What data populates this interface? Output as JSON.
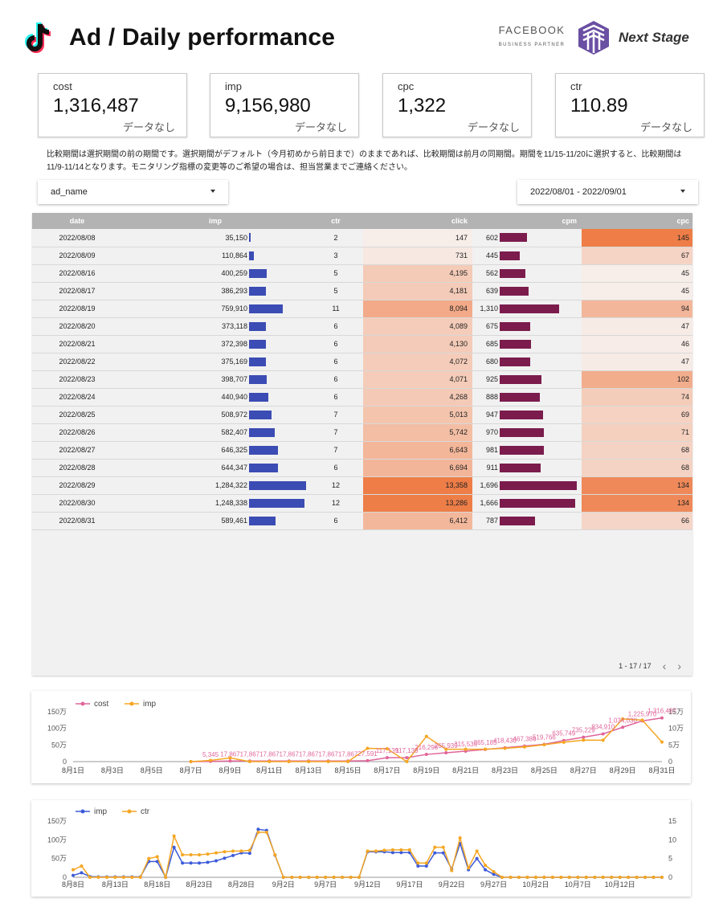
{
  "header": {
    "title": "Ad / Daily performance",
    "partner_top": "FACEBOOK",
    "partner_bottom": "BUSINESS PARTNER",
    "brand": "Next Stage"
  },
  "kpis": [
    {
      "label": "cost",
      "value": "1,316,487",
      "compare": "データなし"
    },
    {
      "label": "imp",
      "value": "9,156,980",
      "compare": "データなし"
    },
    {
      "label": "cpc",
      "value": "1,322",
      "compare": "データなし"
    },
    {
      "label": "ctr",
      "value": "110.89",
      "compare": "データなし"
    }
  ],
  "note": "比較期間は選択期間の前の期間です。選択期間がデフォルト（今月初めから前日まで）のままであれば、比較期間は前月の同期間。期間を11/15-11/20に選択すると、比較期間は11/9-11/14となります。モニタリング指標の変更等のご希望の場合は、担当営業までご連絡ください。",
  "filters": {
    "dimension": "ad_name",
    "date_range": "2022/08/01 - 2022/09/01"
  },
  "table": {
    "columns": [
      "date",
      "imp",
      "ctr",
      "click",
      "cpm",
      "cpc"
    ],
    "rows": [
      {
        "date": "2022/08/08",
        "imp": "35,150",
        "imp_v": 35150,
        "ctr": "2",
        "click": "147",
        "click_v": 147,
        "cpm": "602",
        "cpm_v": 602,
        "cpc": "145",
        "cpc_v": 145
      },
      {
        "date": "2022/08/09",
        "imp": "110,864",
        "imp_v": 110864,
        "ctr": "3",
        "click": "731",
        "click_v": 731,
        "cpm": "445",
        "cpm_v": 445,
        "cpc": "67",
        "cpc_v": 67
      },
      {
        "date": "2022/08/16",
        "imp": "400,259",
        "imp_v": 400259,
        "ctr": "5",
        "click": "4,195",
        "click_v": 4195,
        "cpm": "562",
        "cpm_v": 562,
        "cpc": "45",
        "cpc_v": 45
      },
      {
        "date": "2022/08/17",
        "imp": "386,293",
        "imp_v": 386293,
        "ctr": "5",
        "click": "4,181",
        "click_v": 4181,
        "cpm": "639",
        "cpm_v": 639,
        "cpc": "45",
        "cpc_v": 45
      },
      {
        "date": "2022/08/19",
        "imp": "759,910",
        "imp_v": 759910,
        "ctr": "11",
        "click": "8,094",
        "click_v": 8094,
        "cpm": "1,310",
        "cpm_v": 1310,
        "cpc": "94",
        "cpc_v": 94
      },
      {
        "date": "2022/08/20",
        "imp": "373,118",
        "imp_v": 373118,
        "ctr": "6",
        "click": "4,089",
        "click_v": 4089,
        "cpm": "675",
        "cpm_v": 675,
        "cpc": "47",
        "cpc_v": 47
      },
      {
        "date": "2022/08/21",
        "imp": "372,398",
        "imp_v": 372398,
        "ctr": "6",
        "click": "4,130",
        "click_v": 4130,
        "cpm": "685",
        "cpm_v": 685,
        "cpc": "46",
        "cpc_v": 46
      },
      {
        "date": "2022/08/22",
        "imp": "375,169",
        "imp_v": 375169,
        "ctr": "6",
        "click": "4,072",
        "click_v": 4072,
        "cpm": "680",
        "cpm_v": 680,
        "cpc": "47",
        "cpc_v": 47
      },
      {
        "date": "2022/08/23",
        "imp": "398,707",
        "imp_v": 398707,
        "ctr": "6",
        "click": "4,071",
        "click_v": 4071,
        "cpm": "925",
        "cpm_v": 925,
        "cpc": "102",
        "cpc_v": 102
      },
      {
        "date": "2022/08/24",
        "imp": "440,940",
        "imp_v": 440940,
        "ctr": "6",
        "click": "4,268",
        "click_v": 4268,
        "cpm": "888",
        "cpm_v": 888,
        "cpc": "74",
        "cpc_v": 74
      },
      {
        "date": "2022/08/25",
        "imp": "508,972",
        "imp_v": 508972,
        "ctr": "7",
        "click": "5,013",
        "click_v": 5013,
        "cpm": "947",
        "cpm_v": 947,
        "cpc": "69",
        "cpc_v": 69
      },
      {
        "date": "2022/08/26",
        "imp": "582,407",
        "imp_v": 582407,
        "ctr": "7",
        "click": "5,742",
        "click_v": 5742,
        "cpm": "970",
        "cpm_v": 970,
        "cpc": "71",
        "cpc_v": 71
      },
      {
        "date": "2022/08/27",
        "imp": "646,325",
        "imp_v": 646325,
        "ctr": "7",
        "click": "6,643",
        "click_v": 6643,
        "cpm": "981",
        "cpm_v": 981,
        "cpc": "68",
        "cpc_v": 68
      },
      {
        "date": "2022/08/28",
        "imp": "644,347",
        "imp_v": 644347,
        "ctr": "6",
        "click": "6,694",
        "click_v": 6694,
        "cpm": "911",
        "cpm_v": 911,
        "cpc": "68",
        "cpc_v": 68
      },
      {
        "date": "2022/08/29",
        "imp": "1,284,322",
        "imp_v": 1284322,
        "ctr": "12",
        "click": "13,358",
        "click_v": 13358,
        "cpm": "1,696",
        "cpm_v": 1696,
        "cpc": "134",
        "cpc_v": 134
      },
      {
        "date": "2022/08/30",
        "imp": "1,248,338",
        "imp_v": 1248338,
        "ctr": "12",
        "click": "13,286",
        "click_v": 13286,
        "cpm": "1,666",
        "cpm_v": 1666,
        "cpc": "134",
        "cpc_v": 134
      },
      {
        "date": "2022/08/31",
        "imp": "589,461",
        "imp_v": 589461,
        "ctr": "6",
        "click": "6,412",
        "click_v": 6412,
        "cpm": "787",
        "cpm_v": 787,
        "cpc": "66",
        "cpc_v": 66
      }
    ],
    "pagination": "1 - 17 / 17",
    "prev_icon": "chevron-left-icon",
    "next_icon": "chevron-right-icon"
  },
  "colors": {
    "imp_bar": "#3b4cb4",
    "cpm_bar": "#7b1c4d",
    "heat_high": "#ee7d47",
    "heat_low": "#f7ede9",
    "cost_line": "#e0659a",
    "imp_line_orange": "#f5a623",
    "imp_line_blue": "#3d5bd9"
  },
  "chart_data": [
    {
      "type": "line",
      "series": [
        {
          "name": "cost",
          "color": "#e0659a",
          "axis": "left",
          "x": [
            "8/7",
            "8/8",
            "8/9",
            "8/10",
            "8/11",
            "8/12",
            "8/13",
            "8/14",
            "8/15",
            "8/16",
            "8/17",
            "8/18",
            "8/19",
            "8/20",
            "8/21",
            "8/22",
            "8/23",
            "8/24",
            "8/25",
            "8/26",
            "8/27",
            "8/28",
            "8/29",
            "8/30",
            "8/31"
          ],
          "values": [
            0,
            5345,
            17867,
            17867,
            17867,
            17867,
            17867,
            17867,
            17867,
            27591,
            117139,
            117139,
            216296,
            265939,
            315535,
            365185,
            418430,
            467386,
            519766,
            635749,
            735229,
            834910,
            1034030,
            1225970,
            1316487
          ]
        },
        {
          "name": "imp",
          "color": "#f5a623",
          "axis": "right",
          "x": [
            "8/7",
            "8/8",
            "8/9",
            "8/10",
            "8/11",
            "8/12",
            "8/13",
            "8/14",
            "8/15",
            "8/16",
            "8/17",
            "8/18",
            "8/19",
            "8/20",
            "8/21",
            "8/22",
            "8/23",
            "8/24",
            "8/25",
            "8/26",
            "8/27",
            "8/28",
            "8/29",
            "8/30",
            "8/31"
          ],
          "values": [
            0,
            35150,
            110864,
            0,
            0,
            0,
            0,
            0,
            0,
            400259,
            386293,
            0,
            759910,
            373118,
            372398,
            375169,
            398707,
            440940,
            508972,
            582407,
            646325,
            644347,
            1284322,
            1248338,
            589461
          ]
        }
      ],
      "point_labels": [
        "5,345",
        "17,867",
        "17,867",
        "17,867",
        "17,867",
        "17,867",
        "17,867",
        "17,867",
        "27,591",
        "117,139",
        "117,139",
        "216,296",
        "265,939",
        "315,535",
        "365,185",
        "418,430",
        "467,386",
        "519,766",
        "635,749",
        "735,229",
        "834,910",
        "1,034,030",
        "1,225,970",
        "1,316,487"
      ],
      "xticks": [
        "8月1日",
        "8月3日",
        "8月5日",
        "8月7日",
        "8月9日",
        "8月11日",
        "8月13日",
        "8月15日",
        "8月17日",
        "8月19日",
        "8月21日",
        "8月23日",
        "8月25日",
        "8月27日",
        "8月29日",
        "8月31日"
      ],
      "yticks_left": [
        "0",
        "50万",
        "100万",
        "150万"
      ],
      "yticks_right": [
        "0",
        "5万",
        "10万",
        "15万"
      ],
      "legend": [
        "cost",
        "imp"
      ],
      "ylim_left": [
        0,
        1500000
      ]
    },
    {
      "type": "line",
      "series": [
        {
          "name": "imp",
          "color": "#3d5bd9",
          "axis": "left",
          "values": [
            5,
            12,
            2,
            1,
            1,
            1,
            1,
            1,
            1,
            42,
            42,
            0,
            80,
            38,
            38,
            38,
            40,
            44,
            51,
            58,
            65,
            64,
            128,
            125,
            59,
            0,
            0,
            0,
            0,
            0,
            0,
            0,
            0,
            0,
            0,
            68,
            68,
            68,
            66,
            66,
            66,
            30,
            30,
            65,
            65,
            22,
            90,
            20,
            50,
            20,
            8,
            0,
            0,
            0,
            0,
            0,
            0,
            0,
            0,
            0,
            0,
            0,
            0,
            0,
            0,
            0,
            0,
            0,
            0,
            0,
            0
          ]
        },
        {
          "name": "ctr",
          "color": "#f5a623",
          "axis": "right",
          "values": [
            2,
            3,
            0,
            0,
            0,
            0,
            0,
            0,
            0,
            5,
            5.5,
            0,
            11,
            6,
            6,
            6,
            6.2,
            6.5,
            6.8,
            7,
            7,
            7.2,
            12,
            12,
            6,
            0,
            0,
            0,
            0,
            0,
            0,
            0,
            0,
            0,
            0,
            7,
            7,
            7.2,
            7.3,
            7.3,
            7.3,
            3.8,
            3.8,
            8,
            8,
            1.8,
            10.5,
            2.5,
            7,
            3.2,
            1.5,
            0,
            0,
            0,
            0,
            0,
            0,
            0,
            0,
            0,
            0,
            0,
            0,
            0,
            0,
            0,
            0,
            0,
            0,
            0,
            0
          ]
        }
      ],
      "xticks": [
        "8月8日",
        "8月13日",
        "8月18日",
        "8月23日",
        "8月28日",
        "9月2日",
        "9月7日",
        "9月12日",
        "9月17日",
        "9月22日",
        "9月27日",
        "10月2日",
        "10月7日",
        "10月12日"
      ],
      "yticks_left": [
        "0",
        "50万",
        "100万",
        "150万"
      ],
      "yticks_right": [
        "0",
        "5",
        "10",
        "15"
      ],
      "legend": [
        "imp",
        "ctr"
      ],
      "ylim_left": [
        0,
        1500000
      ],
      "ylim_right": [
        0,
        15
      ]
    }
  ]
}
